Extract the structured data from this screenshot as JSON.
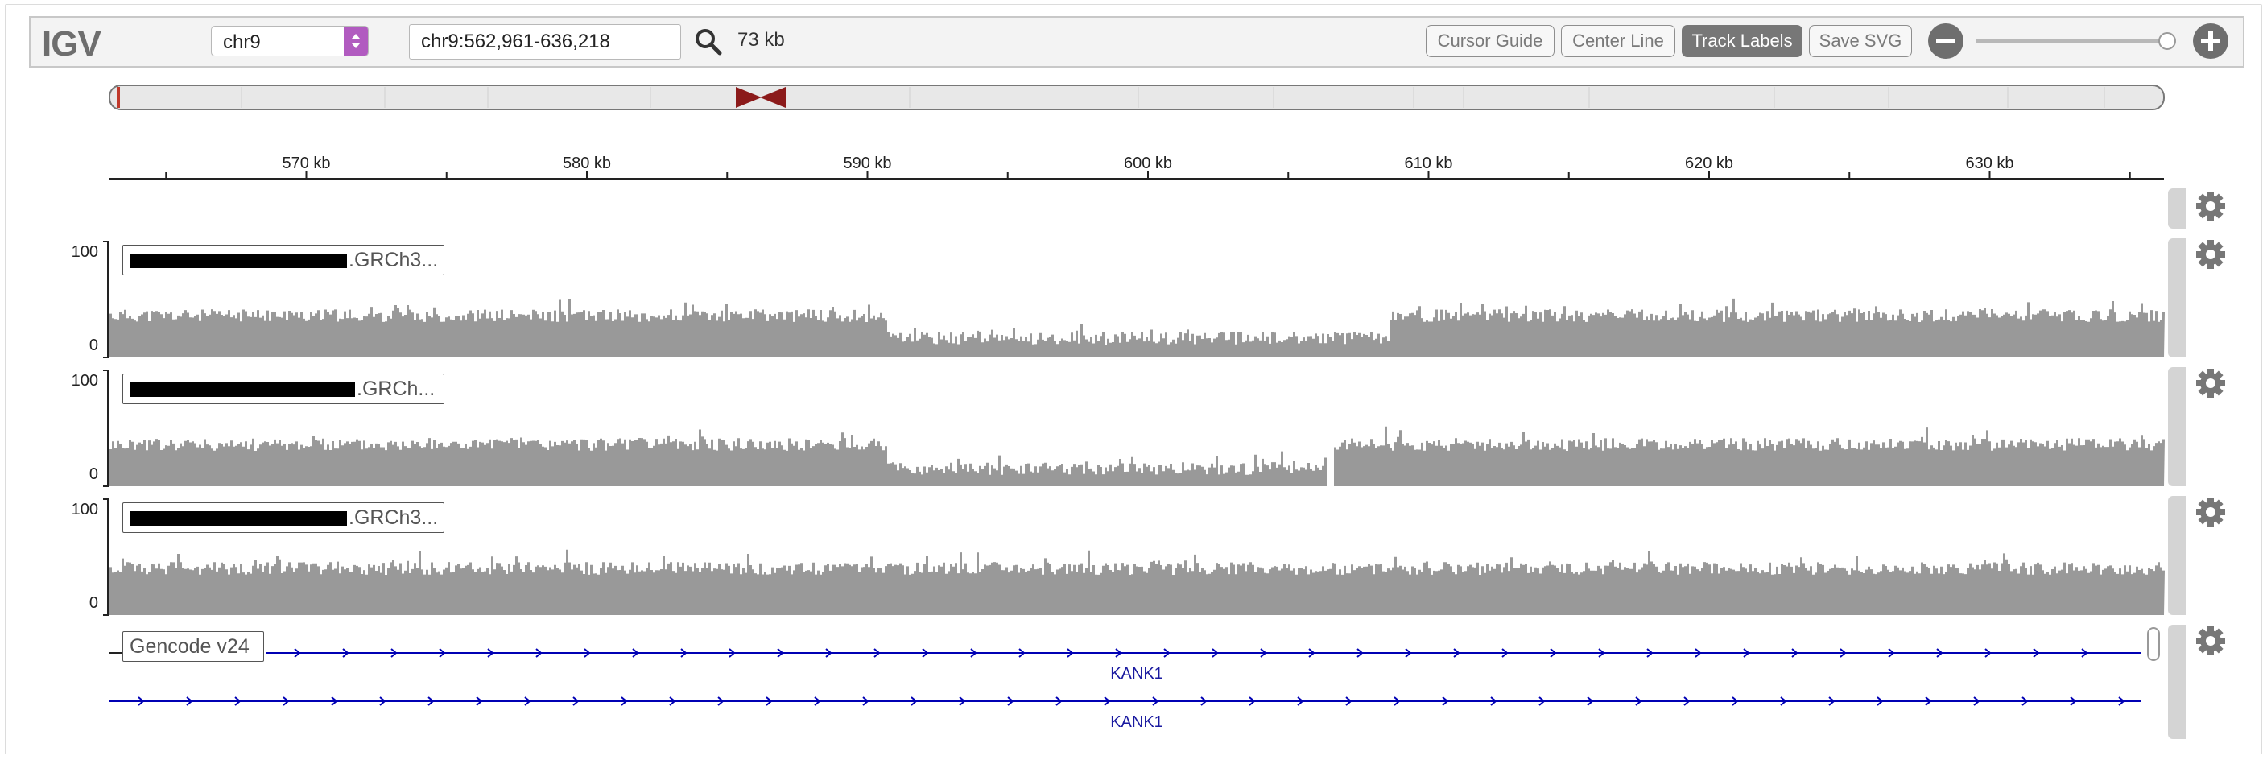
{
  "app": {
    "logo": "IGV"
  },
  "navbar": {
    "chromosome": "chr9",
    "locus": "chr9:562,961-636,218",
    "window_size": "73 kb",
    "buttons": {
      "cursor_guide": "Cursor Guide",
      "center_line": "Center Line",
      "track_labels": "Track Labels",
      "save_svg": "Save SVG"
    },
    "zoom_level_fraction": 0.98
  },
  "ruler": {
    "ticks": [
      "570 kb",
      "580 kb",
      "590 kb",
      "600 kb",
      "610 kb",
      "620 kb",
      "630 kb"
    ]
  },
  "tracks": [
    {
      "label_suffix": ".GRCh3...",
      "axis_max": "100",
      "axis_min": "0"
    },
    {
      "label_suffix": ".GRCh...",
      "axis_max": "100",
      "axis_min": "0"
    },
    {
      "label_suffix": ".GRCh3...",
      "axis_max": "100",
      "axis_min": "0"
    }
  ],
  "annotation": {
    "label": "Gencode v24",
    "genes": [
      "KANK1",
      "KANK1"
    ]
  },
  "colors": {
    "coverage": "#999999",
    "gene": "#0000b4",
    "ideogram_marker": "#8b1a1a",
    "active_button": "#777777",
    "chrom_select_accent": "#b15bc0"
  }
}
